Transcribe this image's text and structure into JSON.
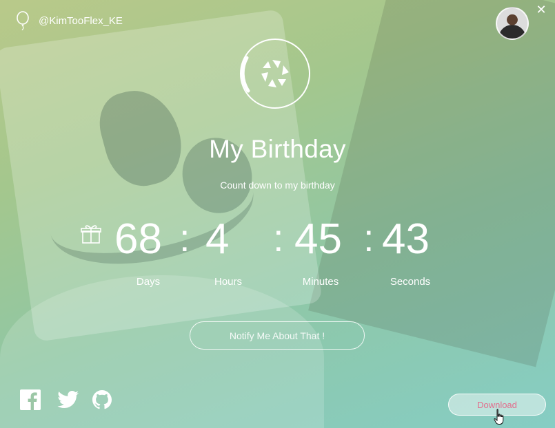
{
  "header": {
    "handle": "@KimTooFlex_KE",
    "balloon_icon": "balloon-icon",
    "close_label": "✕"
  },
  "main": {
    "title": "My Birthday",
    "subtitle": "Count down to my birthday",
    "countdown": {
      "days": "68",
      "hours": "4",
      "minutes": "45",
      "seconds": "43",
      "separator": ":",
      "units": {
        "days": "Days",
        "hours": "Hours",
        "minutes": "Minutes",
        "seconds": "Seconds"
      }
    },
    "notify_label": "Notify Me About That !"
  },
  "footer": {
    "social_icons": [
      "facebook-icon",
      "twitter-icon",
      "github-icon"
    ],
    "download_label": "Download"
  },
  "colors": {
    "accent_text": "#e36b8b",
    "foreground": "#ffffff"
  }
}
